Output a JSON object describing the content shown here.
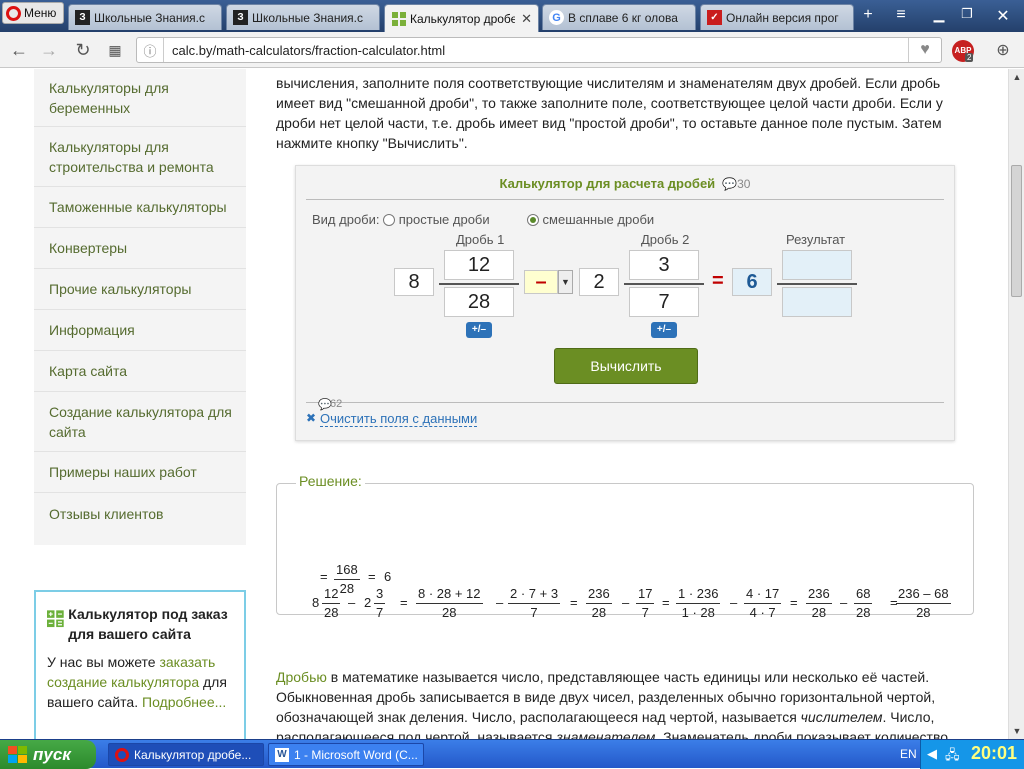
{
  "browser": {
    "menu_label": "Меню",
    "tabs": [
      {
        "title": "Школьные Знания.с",
        "icon": "znanija-icon",
        "active": false
      },
      {
        "title": "Школьные Знания.с",
        "icon": "znanija-icon",
        "active": false
      },
      {
        "title": "Калькулятор дробе",
        "icon": "calc-icon",
        "active": true
      },
      {
        "title": "В сплаве 6 кг олова",
        "icon": "google-icon",
        "active": false
      },
      {
        "title": "Онлайн версия прог",
        "icon": "red-app-icon",
        "active": false
      }
    ],
    "url": "calc.by/math-calculators/fraction-calculator.html",
    "adblock_badge": "2"
  },
  "sidebar": {
    "items": [
      {
        "label": "Калькуляторы для беременных"
      },
      {
        "label": "Калькуляторы для строительства и ремонта"
      },
      {
        "label": "Таможенные калькуляторы"
      },
      {
        "label": "Конвертеры"
      },
      {
        "label": "Прочие калькуляторы"
      },
      {
        "label": "Информация"
      },
      {
        "label": "Карта сайта"
      },
      {
        "label": "Создание калькулятора для сайта"
      },
      {
        "label": "Примеры наших работ"
      },
      {
        "label": "Отзывы клиентов"
      }
    ],
    "promo": {
      "title": "Калькулятор под заказ для вашего сайта",
      "text_before": "У нас вы можете ",
      "link1": "заказать создание калькулятора",
      "text_mid": " для вашего сайта. ",
      "link2": "Подробнее..."
    }
  },
  "intro_text": "вычисления, заполните поля соответствующие числителям и знаменателям двух дробей. Если дробь имеет вид \"смешанной дроби\", то также заполните поле, соответствующее целой части дроби. Если у дроби нет целой части, т.е. дробь имеет вид \"простой дроби\", то оставьте данное поле пустым. Затем нажмите кнопку \"Вычислить\".",
  "calculator": {
    "title": "Калькулятор для расчета дробей",
    "comments_count": "30",
    "type_label": "Вид дроби:",
    "option_simple": "простые дроби",
    "option_mixed": "смешанные дроби",
    "selected": "mixed",
    "fraction1_label": "Дробь 1",
    "fraction2_label": "Дробь 2",
    "result_label": "Результат",
    "f1_whole": "8",
    "f1_num": "12",
    "f1_den": "28",
    "operator": "–",
    "f2_whole": "2",
    "f2_num": "3",
    "f2_den": "7",
    "equals": "=",
    "result_whole": "6",
    "result_num": "",
    "result_den": "",
    "sign_button": "+/–",
    "calc_button": "Вычислить",
    "bottom_comments": "62",
    "clear_link": "Очистить поля с данными"
  },
  "solution": {
    "legend": "Решение:",
    "line1": [
      {
        "whole": "8",
        "n": "12",
        "d": "28"
      },
      {
        "op": "–"
      },
      {
        "whole": "2",
        "n": "3",
        "d": "7"
      },
      {
        "op": "="
      },
      {
        "n": "8 · 28 + 12",
        "d": "28"
      },
      {
        "op": "–"
      },
      {
        "n": "2 · 7 + 3",
        "d": "7"
      },
      {
        "op": "="
      },
      {
        "n": "236",
        "d": "28"
      },
      {
        "op": "–"
      },
      {
        "n": "17",
        "d": "7"
      },
      {
        "op": "="
      },
      {
        "n": "1 · 236",
        "d": "1 · 28"
      },
      {
        "op": "–"
      },
      {
        "n": "4 · 17",
        "d": "4 · 7"
      },
      {
        "op": "="
      },
      {
        "n": "236",
        "d": "28"
      },
      {
        "op": "–"
      },
      {
        "n": "68",
        "d": "28"
      },
      {
        "op": "="
      },
      {
        "n": "236 – 68",
        "d": "28"
      }
    ],
    "line2_eq": "=",
    "line2_n": "168",
    "line2_d": "28",
    "line2_res_eq": "=",
    "line2_result": "6"
  },
  "article": {
    "term": "Дробью",
    "text1": " в математике называется число, представляющее часть единицы или несколько её частей. Обыкновенная дробь записывается в виде двух чисел, разделенных обычно горизонтальной чертой, обозначающей знак деления. Число, располагающееся над чертой, называется ",
    "numerator": "числителем",
    "text2": ". Число, располагающееся под чертой, называется ",
    "denominator": "знаменателем",
    "text3": ". Знаменатель дроби показывает количество"
  },
  "taskbar": {
    "start": "пуск",
    "tasks": [
      {
        "label": "Калькулятор дробе..."
      },
      {
        "label": "1 - Microsoft Word (С..."
      }
    ],
    "lang": "EN",
    "clock": "20:01"
  }
}
